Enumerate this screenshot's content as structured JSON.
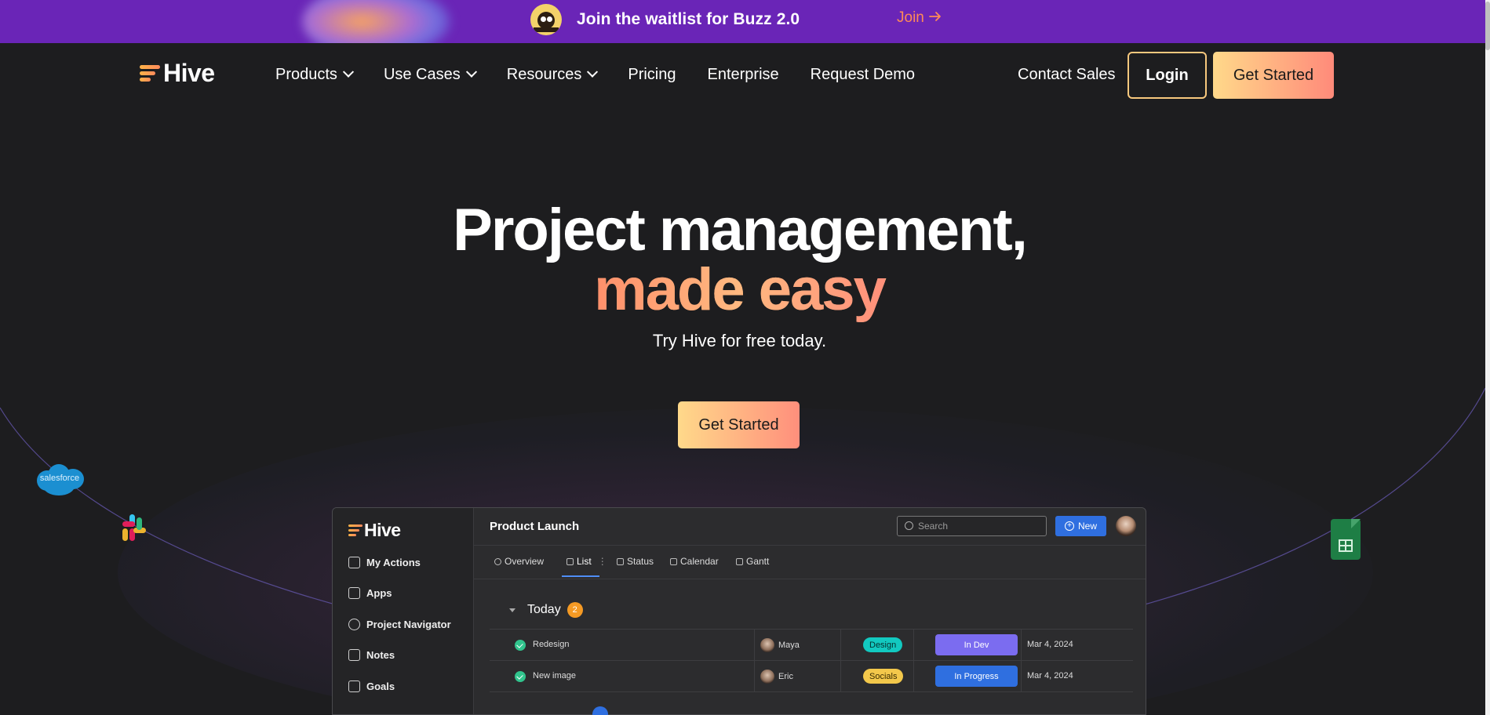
{
  "promo": {
    "text": "Join the waitlist for Buzz 2.0",
    "join_label": "Join"
  },
  "nav": {
    "logo": "Hive",
    "items": [
      {
        "label": "Products",
        "dropdown": true
      },
      {
        "label": "Use Cases",
        "dropdown": true
      },
      {
        "label": "Resources",
        "dropdown": true
      },
      {
        "label": "Pricing",
        "dropdown": false
      },
      {
        "label": "Enterprise",
        "dropdown": false
      },
      {
        "label": "Request Demo",
        "dropdown": false
      }
    ],
    "contact_sales": "Contact Sales",
    "login": "Login",
    "get_started": "Get Started"
  },
  "hero": {
    "title_line1": "Project management,",
    "title_line2": "made easy",
    "subtitle": "Try Hive for free today.",
    "cta": "Get Started"
  },
  "integrations": {
    "salesforce_label": "salesforce"
  },
  "app_preview": {
    "logo": "Hive",
    "sidebar": [
      {
        "label": "My Actions",
        "icon": "home-icon"
      },
      {
        "label": "Apps",
        "icon": "grid-icon"
      },
      {
        "label": "Project Navigator",
        "icon": "compass-icon"
      },
      {
        "label": "Notes",
        "icon": "note-icon"
      },
      {
        "label": "Goals",
        "icon": "goal-icon"
      }
    ],
    "project_title": "Product Launch",
    "search_placeholder": "Search",
    "new_label": "New",
    "tabs": [
      "Overview",
      "List",
      "Status",
      "Calendar",
      "Gantt"
    ],
    "active_tab": "List",
    "group_label": "Today",
    "group_count": "2",
    "rows": [
      {
        "name": "Redesign",
        "assignee": "Maya",
        "tag": "Design",
        "status": "In Dev",
        "date": "Mar 4, 2024"
      },
      {
        "name": "New image",
        "assignee": "Eric",
        "tag": "Socials",
        "status": "In Progress",
        "date": "Mar 4, 2024"
      }
    ]
  },
  "colors": {
    "promo_bg": "#6a25b7",
    "page_bg": "#1d1d1f",
    "accent_orange": "#ff8a57",
    "cta_gradient_start": "#ffd98a",
    "cta_gradient_end": "#ff8a7a",
    "tag_design": "#12c9c0",
    "tag_socials": "#f3c84b",
    "status_in_dev": "#7b6cf0",
    "status_in_progress": "#2f6fe0"
  }
}
